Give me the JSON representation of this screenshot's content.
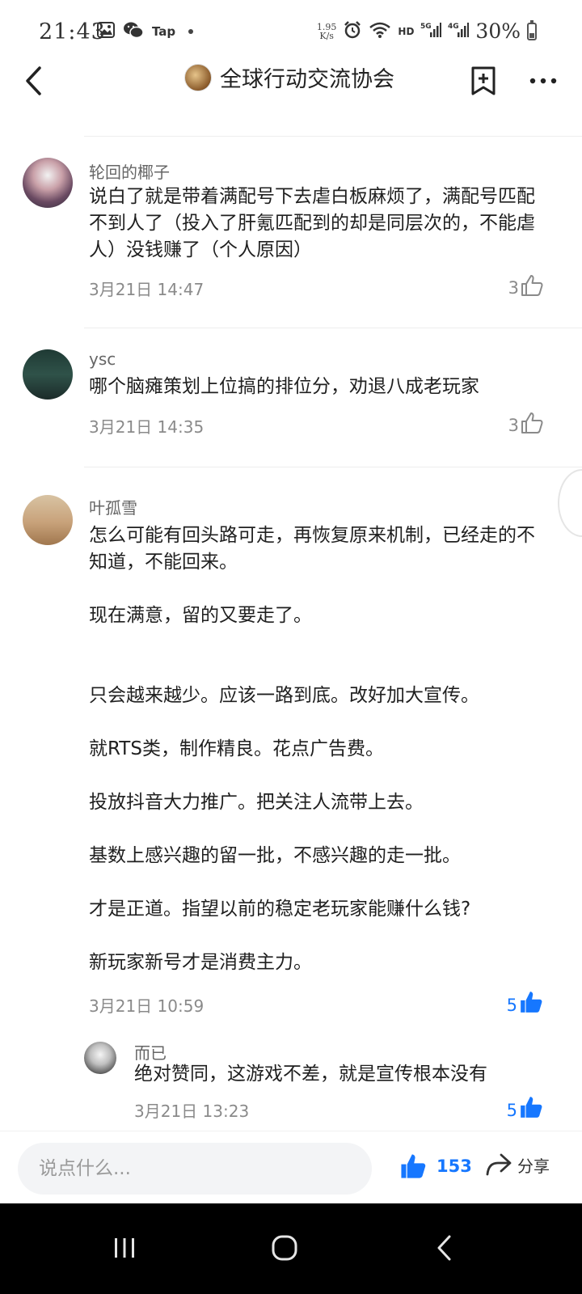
{
  "status_bar": {
    "time": "21:43",
    "tap_label": "Tap",
    "net_speed_value": "1.95",
    "net_speed_unit": "K/s",
    "hd_label": "HD",
    "battery_percent": "30%"
  },
  "header": {
    "title": "全球行动交流协会"
  },
  "comments": [
    {
      "author": "轮回的椰子",
      "text": "说白了就是带着满配号下去虐白板麻烦了，满配号匹配不到人了（投入了肝氪匹配到的却是同层次的，不能虐人）没钱赚了（个人原因）",
      "time": "3月21日 14:47",
      "likes": "3"
    },
    {
      "author": "ysc",
      "text": "哪个脑瘫策划上位搞的排位分，劝退八成老玩家",
      "time": "3月21日 14:35",
      "likes": "3"
    },
    {
      "author": "叶孤雪",
      "text": "怎么可能有回头路可走，再恢复原来机制，已经走的不知道，不能回来。\n\n现在满意，留的又要走了。\n\n\n只会越来越少。应该一路到底。改好加大宣传。\n\n就RTS类，制作精良。花点广告费。\n\n投放抖音大力推广。把关注人流带上去。\n\n基数上感兴趣的留一批，不感兴趣的走一批。\n\n才是正道。指望以前的稳定老玩家能赚什么钱?\n\n新玩家新号才是消费主力。",
      "time": "3月21日 10:59",
      "likes": "5"
    }
  ],
  "reply": {
    "author": "而已",
    "text": "绝对赞同，这游戏不差，就是宣传根本没有",
    "time": "3月21日 13:23",
    "likes": "5"
  },
  "bottom_bar": {
    "input_placeholder": "说点什么...",
    "like_count": "153",
    "share_label": "分享"
  },
  "colors": {
    "accent_blue": "#1677ff",
    "muted_text": "#8a8a8a"
  },
  "icons": [
    "back-icon",
    "bookmark-icon",
    "more-icon",
    "thumbs-up-icon",
    "share-icon",
    "nav-recents-icon",
    "nav-home-icon",
    "nav-back-icon"
  ]
}
